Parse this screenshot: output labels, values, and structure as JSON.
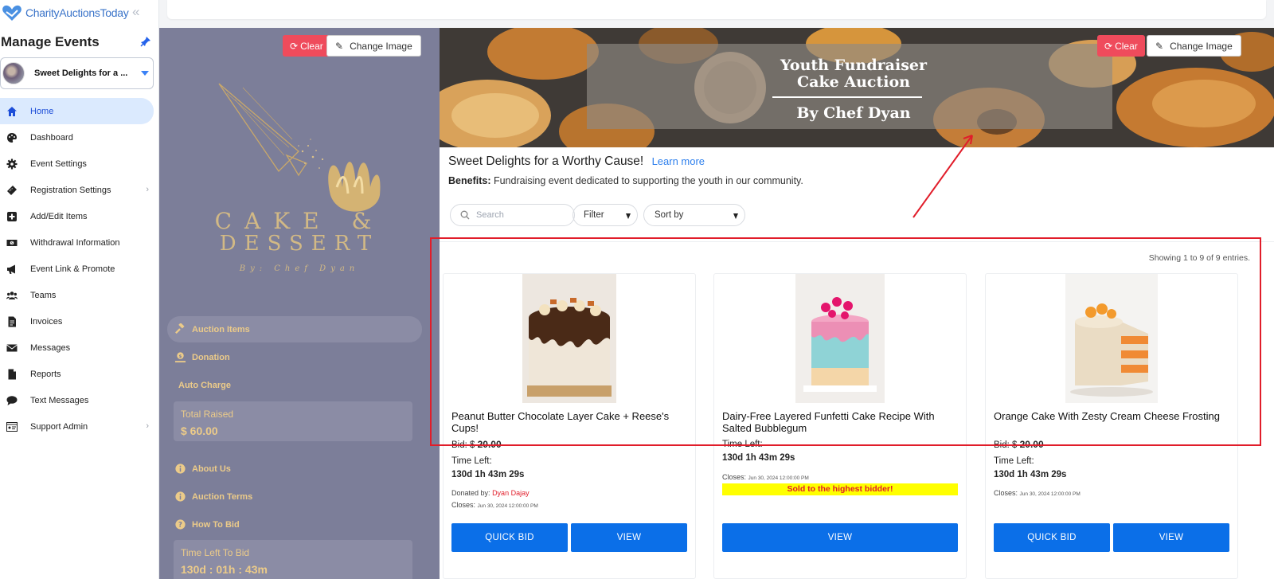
{
  "app": {
    "brand_name": "CharityAuctionsToday",
    "collapse_glyph": "«"
  },
  "sidebar": {
    "title": "Manage Events",
    "event_select": {
      "value": "Sweet Delights for a ..."
    },
    "items": [
      {
        "label": "Home",
        "icon": "home-icon",
        "active": true
      },
      {
        "label": "Dashboard",
        "icon": "palette-icon"
      },
      {
        "label": "Event Settings",
        "icon": "gear-icon"
      },
      {
        "label": "Registration Settings",
        "icon": "ticket-icon",
        "has_submenu": true
      },
      {
        "label": "Add/Edit Items",
        "icon": "plus-square-icon"
      },
      {
        "label": "Withdrawal Information",
        "icon": "money-icon"
      },
      {
        "label": "Event Link & Promote",
        "icon": "megaphone-icon"
      },
      {
        "label": "Teams",
        "icon": "users-icon"
      },
      {
        "label": "Invoices",
        "icon": "invoice-icon"
      },
      {
        "label": "Messages",
        "icon": "envelope-icon"
      },
      {
        "label": "Reports",
        "icon": "file-icon"
      },
      {
        "label": "Text Messages",
        "icon": "chat-icon"
      },
      {
        "label": "Support Admin",
        "icon": "admin-icon",
        "has_submenu": true
      }
    ]
  },
  "event_panel": {
    "clear_label": "Clear",
    "change_image_label": "Change Image",
    "logo": {
      "line1": "CAKE &",
      "line2": "DESSERT",
      "line3": "By: Chef Dyan"
    },
    "menu": {
      "auction_items": "Auction Items",
      "donation": "Donation",
      "auto_charge": "Auto Charge",
      "total_raised_label": "Total Raised",
      "total_raised_value": "$ 60.00",
      "about_us": "About Us",
      "auction_terms": "Auction Terms",
      "how_to_bid": "How To Bid",
      "time_left_label": "Time Left To Bid",
      "time_left_value": "130d : 01h : 43m"
    }
  },
  "banner": {
    "clear_label": "Clear",
    "change_image_label": "Change Image",
    "title_line1": "Youth Fundraiser",
    "title_line2": "Cake Auction",
    "title_line3": "By Chef Dyan"
  },
  "event": {
    "title": "Sweet Delights for a Worthy Cause!",
    "learn_more": "Learn more",
    "benefits_label": "Benefits:",
    "benefits_text": "Fundraising event dedicated to supporting the youth in our community."
  },
  "filters": {
    "search_placeholder": "Search",
    "filter_label": "Filter",
    "sort_label": "Sort by"
  },
  "entries_text": "Showing 1 to 9 of 9 entries.",
  "items": [
    {
      "title": "Peanut Butter Chocolate Layer Cake + Reese's Cups!",
      "bid_label": "Bid: $",
      "bid_value": "20.00",
      "time_left_label": "Time Left:",
      "time_left_value": "130d 1h 43m 29s",
      "donated_by_label": "Donated by:",
      "donated_by": "Dyan Dajay",
      "closes_label": "Closes:",
      "closes_value": "Jun 30, 2024 12:00:00 PM",
      "quick_bid_label": "QUICK BID",
      "view_label": "VIEW"
    },
    {
      "title": "Dairy-Free Layered Funfetti Cake Recipe With Salted Bubblegum",
      "time_left_label": "Time Left:",
      "time_left_value": "130d 1h 43m 29s",
      "closes_label": "Closes:",
      "closes_value": "Jun 30, 2024 12:00:00 PM",
      "sold_text": "Sold to the highest bidder!",
      "view_label": "VIEW"
    },
    {
      "title": "Orange Cake With Zesty Cream Cheese Frosting",
      "bid_label": "Bid: $",
      "bid_value": "20.00",
      "time_left_label": "Time Left:",
      "time_left_value": "130d 1h 43m 29s",
      "closes_label": "Closes:",
      "closes_value": "Jun 30, 2024 12:00:00 PM",
      "quick_bid_label": "QUICK BID",
      "view_label": "VIEW"
    }
  ],
  "colors": {
    "accent": "#0b6fe8",
    "panel": "#7c7e99",
    "gold": "#eccb89",
    "annotation": "#e11d2a",
    "sold_bg": "#ffff00"
  }
}
